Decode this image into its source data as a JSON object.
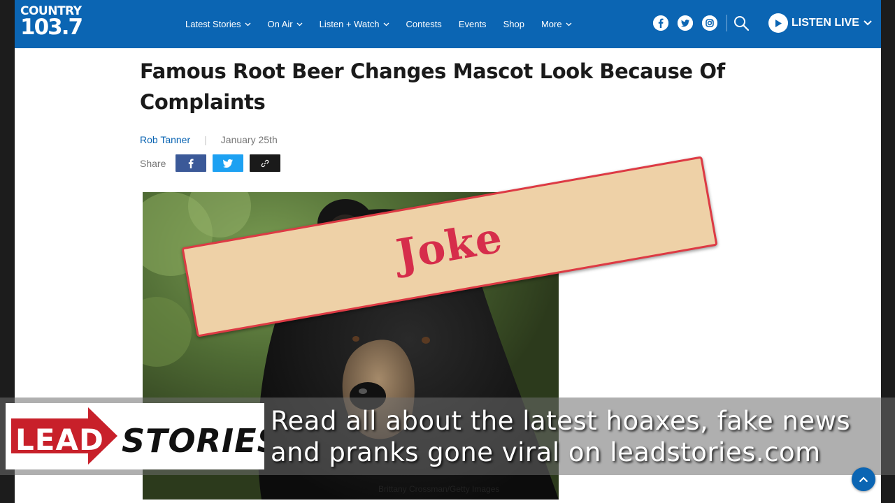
{
  "header": {
    "logo_line1": "COUNTRY",
    "logo_line2": "103.7",
    "nav": [
      {
        "label": "Latest Stories",
        "has_dropdown": true
      },
      {
        "label": "On Air",
        "has_dropdown": true
      },
      {
        "label": "Listen + Watch",
        "has_dropdown": true
      },
      {
        "label": "Contests",
        "has_dropdown": false
      },
      {
        "label": "Events",
        "has_dropdown": false
      },
      {
        "label": "Shop",
        "has_dropdown": false
      },
      {
        "label": "More",
        "has_dropdown": true
      }
    ],
    "social_icons": [
      "facebook-icon",
      "twitter-icon",
      "instagram-icon"
    ],
    "listen_live_label": "LISTEN LIVE"
  },
  "article": {
    "headline": "Famous Root Beer Changes Mascot Look Because Of Complaints",
    "author": "Rob Tanner",
    "date": "January 25th",
    "share_label": "Share",
    "image_caption": "Brittany Crossman/Getty Images"
  },
  "stamp": {
    "text": "Joke"
  },
  "banner": {
    "logo_left": "LEAD",
    "logo_right": "STORIES",
    "text": "Read all about the latest hoaxes, fake news and pranks gone viral on leadstories.com"
  },
  "colors": {
    "brand_blue": "#0b65b3",
    "stamp_red": "#d62d4b",
    "stamp_fill": "#eed1a7",
    "lead_red": "#c8202a"
  }
}
